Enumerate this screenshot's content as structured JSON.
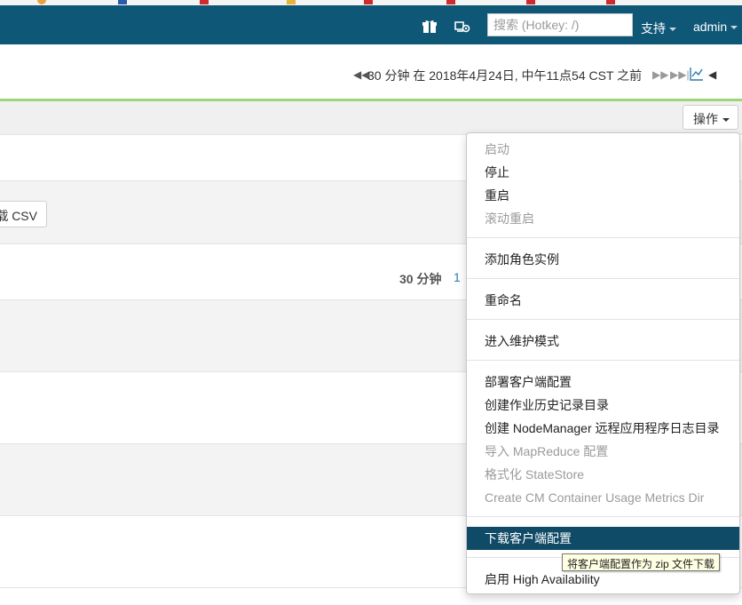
{
  "navbar": {
    "search_placeholder": "搜索 (Hotkey: /)",
    "support_label": "支持",
    "user_label": "admin"
  },
  "timebar": {
    "range_text": "30 分钟 在 2018年4月24日, 中午11点54 CST 之前"
  },
  "toolbar": {
    "actions_label": "操作"
  },
  "content": {
    "csv_label": "载 CSV",
    "duration_label": "30 分钟",
    "duration_link": "1"
  },
  "menu": {
    "items": [
      {
        "label": "启动",
        "disabled": true
      },
      {
        "label": "停止",
        "disabled": false
      },
      {
        "label": "重启",
        "disabled": false
      },
      {
        "label": "滚动重启",
        "disabled": true
      },
      {
        "label": "添加角色实例",
        "disabled": false
      },
      {
        "label": "重命名",
        "disabled": false
      },
      {
        "label": "进入维护模式",
        "disabled": false
      },
      {
        "label": "部署客户端配置",
        "disabled": false
      },
      {
        "label": "创建作业历史记录目录",
        "disabled": false
      },
      {
        "label": "创建 NodeManager 远程应用程序日志目录",
        "disabled": false
      },
      {
        "label": "导入 MapReduce 配置",
        "disabled": true
      },
      {
        "label": "格式化 StateStore",
        "disabled": true
      },
      {
        "label": "Create CM Container Usage Metrics Dir",
        "disabled": true
      },
      {
        "label": "下载客户端配置",
        "disabled": false,
        "active": true
      },
      {
        "label": "启用 High Availability",
        "disabled": false
      }
    ]
  },
  "tooltip": {
    "text": "将客户端配置作为 zip 文件下载"
  },
  "colors": {
    "navbar": "#0f5777",
    "accent_line": "#9bd67a",
    "menu_active": "#0f4a66"
  }
}
